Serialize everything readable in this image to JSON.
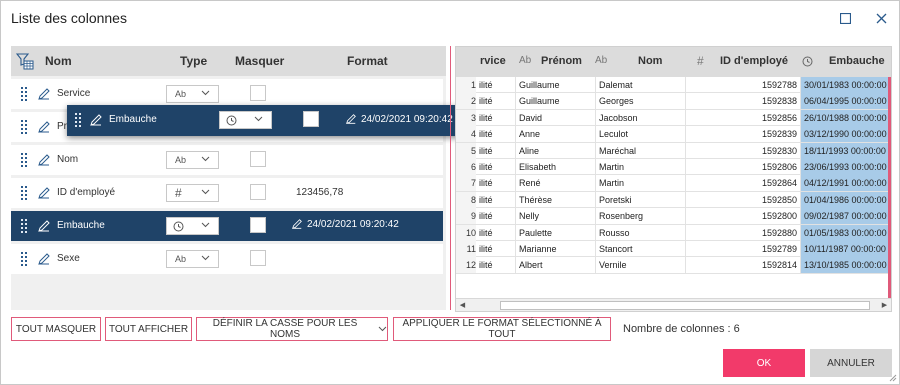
{
  "dialog": {
    "title": "Liste des colonnes",
    "accent_color": "#f23a6a",
    "selection_color": "#1f4368",
    "highlight_color": "#a8cbe8"
  },
  "columns_panel": {
    "headers": {
      "name": "Nom",
      "type": "Type",
      "hide": "Masquer",
      "format": "Format"
    },
    "rows": [
      {
        "name": "Service",
        "type_icon": "text-type-icon",
        "type_label": "Ab",
        "hidden": false,
        "format": ""
      },
      {
        "name": "Prénom",
        "type_icon": "text-type-icon",
        "type_label": "Ab",
        "hidden": false,
        "format": ""
      },
      {
        "name": "Nom",
        "type_icon": "text-type-icon",
        "type_label": "Ab",
        "hidden": false,
        "format": ""
      },
      {
        "name": "ID d'employé",
        "type_icon": "number-type-icon",
        "type_label": "#",
        "hidden": false,
        "format": "123456,78"
      },
      {
        "name": "Embauche",
        "type_icon": "clock-type-icon",
        "type_label": "",
        "hidden": false,
        "format": "24/02/2021 09:20:42",
        "selected": true
      },
      {
        "name": "Sexe",
        "type_icon": "text-type-icon",
        "type_label": "Ab",
        "hidden": false,
        "format": ""
      }
    ],
    "drag_ghost": {
      "name": "Embauche",
      "format": "24/02/2021 09:20:42"
    }
  },
  "preview_grid": {
    "headers": [
      "rvice",
      "Prénom",
      "Nom",
      "ID d'employé",
      "Embauche"
    ],
    "header_type_labels": [
      "Ab",
      "Ab",
      "#"
    ],
    "rows": [
      [
        "1",
        "ilité",
        "Guillaume",
        "Dalemat",
        "1592788",
        "30/01/1983 00:00:00"
      ],
      [
        "2",
        "ilité",
        "Guillaume",
        "Georges",
        "1592838",
        "06/04/1995 00:00:00"
      ],
      [
        "3",
        "ilité",
        "David",
        "Jacobson",
        "1592856",
        "26/10/1988 00:00:00"
      ],
      [
        "4",
        "ilité",
        "Anne",
        "Leculot",
        "1592839",
        "03/12/1990 00:00:00"
      ],
      [
        "5",
        "ilité",
        "Aline",
        "Maréchal",
        "1592830",
        "18/11/1993 00:00:00"
      ],
      [
        "6",
        "ilité",
        "Elisabeth",
        "Martin",
        "1592806",
        "23/06/1993 00:00:00"
      ],
      [
        "7",
        "ilité",
        "René",
        "Martin",
        "1592864",
        "04/12/1991 00:00:00"
      ],
      [
        "8",
        "ilité",
        "Thérèse",
        "Poretski",
        "1592850",
        "01/04/1986 00:00:00"
      ],
      [
        "9",
        "ilité",
        "Nelly",
        "Rosenberg",
        "1592800",
        "09/02/1987 00:00:00"
      ],
      [
        "10",
        "ilité",
        "Paulette",
        "Rousso",
        "1592880",
        "01/05/1983 00:00:00"
      ],
      [
        "11",
        "ilité",
        "Marianne",
        "Stancort",
        "1592789",
        "10/11/1987 00:00:00"
      ],
      [
        "12",
        "ilité",
        "Albert",
        "Vernile",
        "1592814",
        "13/10/1985 00:00:00"
      ]
    ]
  },
  "footer": {
    "hide_all": "TOUT MASQUER",
    "show_all": "TOUT AFFICHER",
    "case_dropdown": "DÉFINIR LA CASSE POUR LES NOMS",
    "apply_format": "APPLIQUER LE FORMAT SÉLECTIONNÉ À TOUT",
    "column_count": "Nombre de colonnes : 6",
    "ok": "OK",
    "cancel": "ANNULER"
  }
}
